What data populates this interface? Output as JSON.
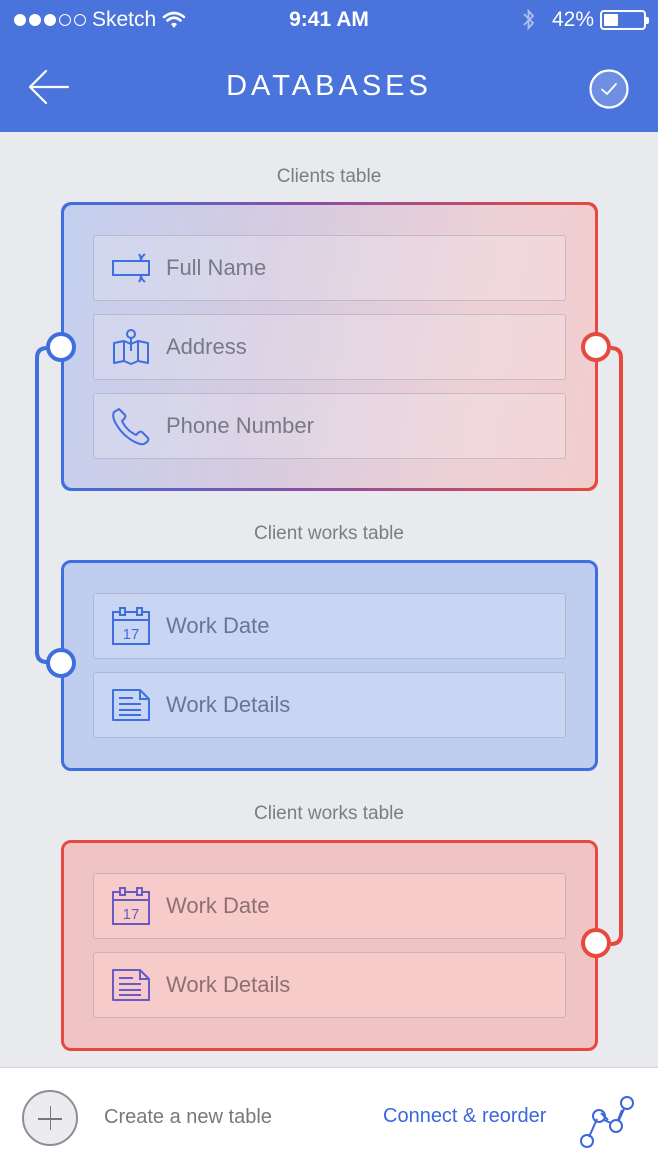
{
  "status_bar": {
    "carrier": "Sketch",
    "signal_bars_filled": 3,
    "signal_bars_total": 5,
    "time": "9:41 AM",
    "battery_percent": "42%",
    "battery_level": 0.42
  },
  "nav": {
    "title": "DATABASES",
    "back_icon": "arrow-left-icon",
    "done_icon": "check-circle-icon"
  },
  "tables": [
    {
      "label": "Clients table",
      "style": "linked-both",
      "fields": [
        {
          "label": "Full Name",
          "icon": "name-tag-icon"
        },
        {
          "label": "Address",
          "icon": "map-pin-icon"
        },
        {
          "label": "Phone Number",
          "icon": "phone-icon"
        }
      ]
    },
    {
      "label": "Client works table",
      "style": "blue",
      "fields": [
        {
          "label": "Work Date",
          "icon": "calendar-icon",
          "icon_text": "17"
        },
        {
          "label": "Work Details",
          "icon": "document-icon"
        }
      ]
    },
    {
      "label": "Client works table",
      "style": "red",
      "fields": [
        {
          "label": "Work Date",
          "icon": "calendar-icon",
          "icon_text": "17"
        },
        {
          "label": "Work Details",
          "icon": "document-icon"
        }
      ]
    }
  ],
  "colors": {
    "primary_blue": "#4a74dc",
    "link_blue": "#3f6fdf",
    "link_red": "#e7493e"
  },
  "bottom_bar": {
    "create_label": "Create a new table",
    "connect_label": "Connect & reorder"
  }
}
